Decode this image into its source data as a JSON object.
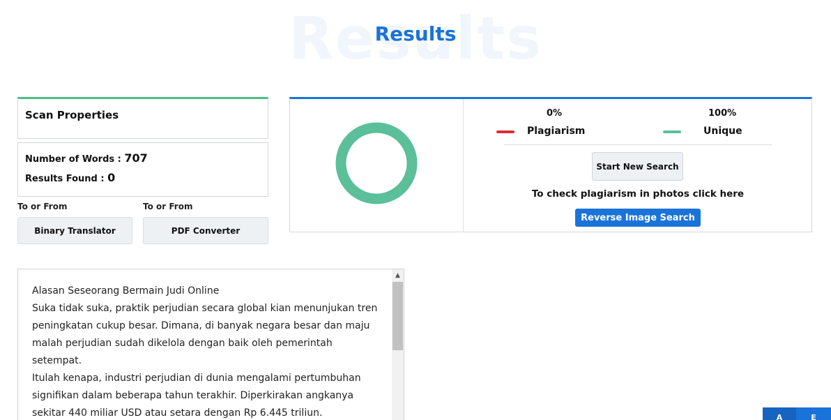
{
  "header": {
    "bg_title": "Results",
    "title": "Results"
  },
  "scan_properties": {
    "heading": "Scan Properties",
    "words_label": "Number of Words : ",
    "words_value": "707",
    "results_label": "Results Found : ",
    "results_value": "0"
  },
  "tools": [
    {
      "caption": "To or From",
      "label": "Binary Translator"
    },
    {
      "caption": "To or From",
      "label": "PDF Converter"
    }
  ],
  "result": {
    "plagiarism_pct": "0%",
    "unique_pct": "100%",
    "plagiarism_label": "Plagiarism",
    "unique_label": "Unique",
    "plagiarism_fraction": 0,
    "unique_fraction": 1,
    "colors": {
      "plagiarism": "#d9302f",
      "unique": "#5bbf9a",
      "accent": "#1a73d9"
    },
    "start_button": "Start New Search",
    "photo_note": "To check plagiarism in photos click here",
    "reverse_button": "Reverse Image Search"
  },
  "text_lines": [
    "Alasan Seseorang Bermain Judi Online",
    "Suka tidak suka, praktik perjudian secara global kian menunjukan tren",
    "peningkatan cukup besar. Dimana, di banyak negara besar dan maju",
    "malah perjudian sudah dikelola dengan baik oleh pemerintah",
    "setempat.",
    "Itulah kenapa, industri perjudian di dunia mengalami pertumbuhan",
    "signifikan dalam beberapa tahun terakhir. Diperkirakan angkanya",
    "sekitar 440 miliar USD atau setara dengan Rp 6.445 triliun."
  ],
  "corner": {
    "item1": "A",
    "item2": "E"
  }
}
